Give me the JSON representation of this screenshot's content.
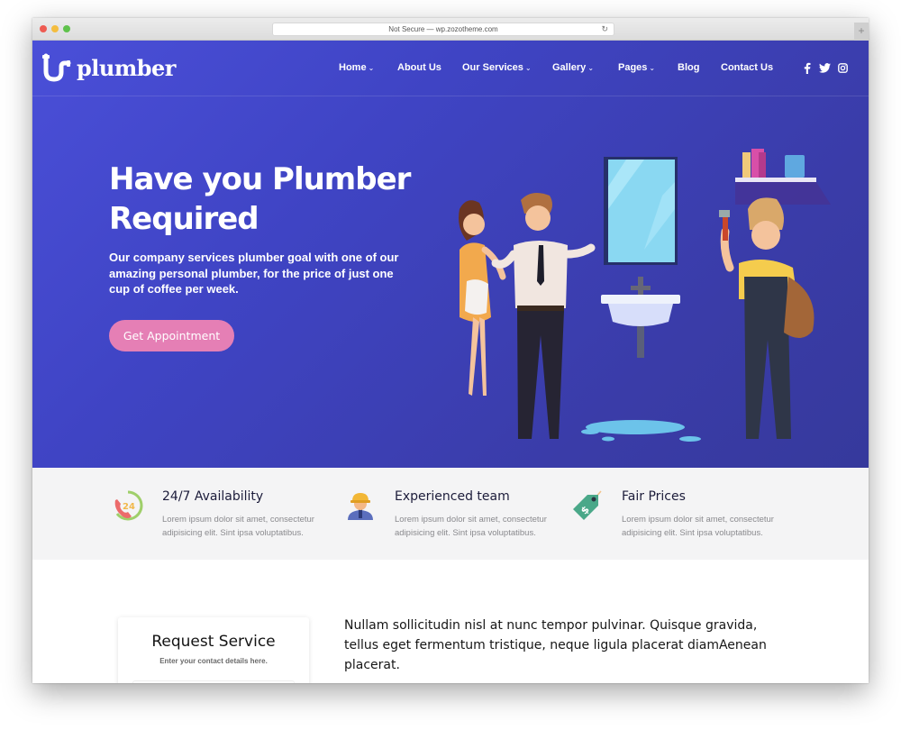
{
  "browser": {
    "address_text": "Not Secure — wp.zozotheme.com",
    "reload_icon": "reload-icon",
    "new_tab_icon": "plus-icon"
  },
  "brand": {
    "name": "plumber",
    "logo_icon": "pipe-icon",
    "primary_color": "#4348c8",
    "accent_color": "#e57fb5"
  },
  "nav": {
    "items": [
      {
        "label": "Home",
        "has_dropdown": true
      },
      {
        "label": "About Us",
        "has_dropdown": false
      },
      {
        "label": "Our Services",
        "has_dropdown": true
      },
      {
        "label": "Gallery",
        "has_dropdown": true
      },
      {
        "label": "Pages",
        "has_dropdown": true
      },
      {
        "label": "Blog",
        "has_dropdown": false
      },
      {
        "label": "Contact Us",
        "has_dropdown": false
      }
    ],
    "chevron": "⌄",
    "social": [
      {
        "name": "facebook-icon",
        "glyph": "f"
      },
      {
        "name": "twitter-icon",
        "glyph": "🐦"
      },
      {
        "name": "instagram-icon",
        "glyph": "◎"
      }
    ]
  },
  "hero": {
    "title": "Have you Plumber Required",
    "subtitle": "Our company services plumber goal with one of our amazing personal plumber, for the price of just one cup of coffee per week.",
    "cta_label": "Get Appointment",
    "illustration": "plumber-bathroom-illustration"
  },
  "features": [
    {
      "icon": "24-hour-phone-icon",
      "title": "24/7 Availability",
      "description": "Lorem ipsum dolor sit amet, consectetur adipisicing elit. Sint ipsa voluptatibus."
    },
    {
      "icon": "worker-icon",
      "title": "Experienced team",
      "description": "Lorem ipsum dolor sit amet, consectetur adipisicing elit. Sint ipsa voluptatibus."
    },
    {
      "icon": "price-tag-icon",
      "title": "Fair Prices",
      "description": "Lorem ipsum dolor sit amet, consectetur adipisicing elit. Sint ipsa voluptatibus."
    }
  ],
  "request": {
    "title": "Request Service",
    "subtitle": "Enter your contact details here."
  },
  "intro": {
    "text": "Nullam sollicitudin nisl at nunc tempor pulvinar. Quisque gravida, tellus eget fermentum tristique, neque ligula placerat diamAenean placerat."
  }
}
